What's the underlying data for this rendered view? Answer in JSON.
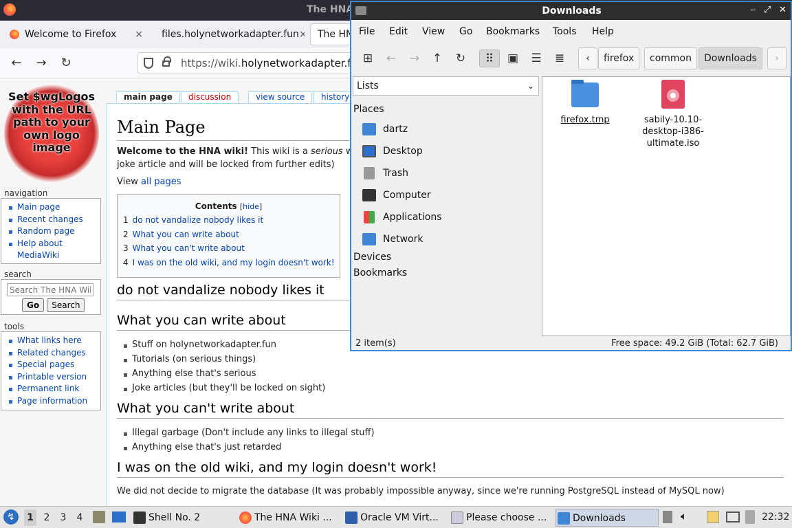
{
  "firefox": {
    "window_title": "The HNA",
    "tabs": [
      {
        "label": "Welcome to Firefox"
      },
      {
        "label": "files.holynetworkadapter.fun"
      },
      {
        "label": "The HNA"
      }
    ],
    "url_prefix": "https://wiki.",
    "url_domain": "holynetworkadapter.fun",
    "close_glyph": "×"
  },
  "wiki": {
    "logo_text": "Set $wgLogos with the URL path to your own logo image",
    "tabs": {
      "main_page": "main page",
      "discussion": "discussion",
      "view_source": "view source",
      "history": "history"
    },
    "title": "Main Page",
    "intro_bold": "Welcome to the HNA wiki!",
    "intro_rest": " This wiki is a ",
    "intro_em": "serious",
    "intro_tail": " wi",
    "intro_line2": "joke article and will be locked from further edits)",
    "view_label": "View ",
    "all_pages": "all pages",
    "navigation": {
      "heading": "navigation",
      "items": [
        "Main page",
        "Recent changes",
        "Random page",
        "Help about MediaWiki"
      ]
    },
    "search": {
      "heading": "search",
      "placeholder": "Search The HNA Wiki",
      "go": "Go",
      "search_btn": "Search"
    },
    "tools": {
      "heading": "tools",
      "items": [
        "What links here",
        "Related changes",
        "Special pages",
        "Printable version",
        "Permanent link",
        "Page information"
      ]
    },
    "toc": {
      "title": "Contents",
      "hide": "hide",
      "entries": [
        {
          "num": "1",
          "text": "do not vandalize nobody likes it"
        },
        {
          "num": "2",
          "text": "What you can write about"
        },
        {
          "num": "3",
          "text": "What you can't write about"
        },
        {
          "num": "4",
          "text": "I was on the old wiki, and my login doesn't work!"
        }
      ]
    },
    "sections": {
      "s1": "do not vandalize nobody likes it",
      "s2": "What you can write about",
      "s2_items": [
        "Stuff on holynetworkadapter.fun",
        "Tutorials (on serious things)",
        "Anything else that's serious",
        "Joke articles (but they'll be locked on sight)"
      ],
      "s3": "What you can't write about",
      "s3_items": [
        "Illegal garbage (Don't include any links to illegal stuff)",
        "Anything else that's just retarded"
      ],
      "s4": "I was on the old wiki, and my login doesn't work!",
      "s4_text": "We did not decide to migrate the database (It was probably impossible anyway, since we're running PostgreSQL instead of MySQL now)"
    }
  },
  "filemanager": {
    "title": "Downloads",
    "menu": [
      "File",
      "Edit",
      "View",
      "Go",
      "Bookmarks",
      "Tools",
      "Help"
    ],
    "breadcrumb": [
      "firefox",
      "common",
      "Downloads"
    ],
    "side_mode": "Lists",
    "places_heading": "Places",
    "places": [
      "dartz",
      "Desktop",
      "Trash",
      "Computer",
      "Applications",
      "Network"
    ],
    "devices_heading": "Devices",
    "bookmarks_heading": "Bookmarks",
    "files": [
      {
        "name": "firefox.tmp",
        "icon": "folder-icon"
      },
      {
        "name": "sabily-10.10-desktop-i386-ultimate.iso",
        "line1": "sabily-10.10-",
        "line2": "desktop-i386-",
        "line3": "ultimate.iso",
        "icon": "disc-image-icon"
      }
    ],
    "status_left": "2 item(s)",
    "status_right": "Free space: 49.2 GiB (Total: 62.7 GiB)"
  },
  "taskbar": {
    "workspaces": [
      "1",
      "2",
      "3",
      "4"
    ],
    "tasks": [
      {
        "label": "Shell No. 2"
      },
      {
        "label": "The HNA Wiki ..."
      },
      {
        "label": "Oracle VM Virt..."
      },
      {
        "label": "Please choose ..."
      },
      {
        "label": "Downloads"
      }
    ],
    "clock": "22:32"
  }
}
